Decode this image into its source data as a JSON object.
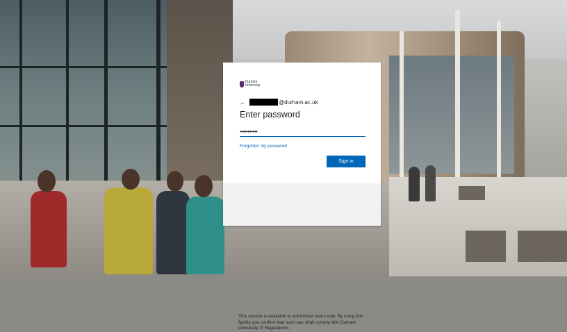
{
  "login": {
    "logo_alt": "Durham University",
    "back_icon": "←",
    "email_suffix": "@durham.ac.uk",
    "title": "Enter password",
    "password_value": "•••••••••••",
    "forgot_link": "Forgotten my password",
    "signin_label": "Sign in",
    "notice": "This service is available to authorised users only. By using this facility you confirm that such use shall comply with Durham University IT Regulations."
  },
  "colors": {
    "accent": "#0067b8",
    "brand": "#5b2a6e"
  },
  "icons": {
    "back": "back-arrow-icon",
    "logo": "durham-crest-icon"
  }
}
